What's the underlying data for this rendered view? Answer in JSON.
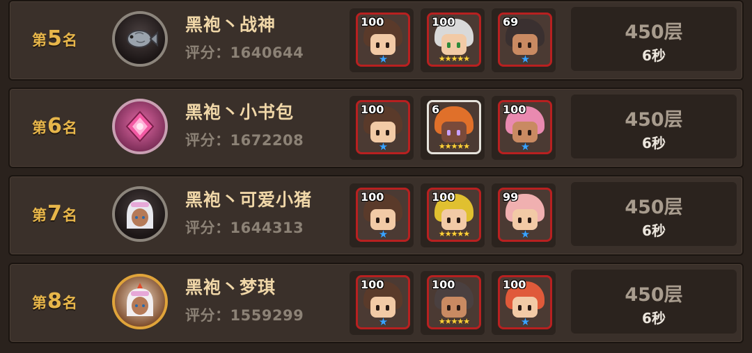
{
  "rankings": [
    {
      "rank_prefix": "第",
      "rank_number": "5",
      "rank_suffix": "名",
      "avatar_icon": "fish-avatar-icon",
      "name": "黑袍丶战神",
      "score": "评分：1640644",
      "heroes": [
        {
          "level": "100",
          "stars": "★",
          "star_color": "blue",
          "hair": "#5a3a2a"
        },
        {
          "level": "100",
          "stars": "★★★★★",
          "star_color": "gold",
          "hair": "#d9d9d9"
        },
        {
          "level": "69",
          "stars": "★",
          "star_color": "blue",
          "hair": "#3a3030"
        }
      ],
      "floor": "450层",
      "time": "6秒"
    },
    {
      "rank_prefix": "第",
      "rank_number": "6",
      "rank_suffix": "名",
      "avatar_icon": "pink-gem-avatar-icon",
      "name": "黑袍丶小书包",
      "score": "评分：1672208",
      "heroes": [
        {
          "level": "100",
          "stars": "★",
          "star_color": "blue",
          "hair": "#5a3a2a"
        },
        {
          "level": "6",
          "stars": "★★★★★",
          "star_color": "gold",
          "hair": "#e0702a"
        },
        {
          "level": "100",
          "stars": "★",
          "star_color": "blue",
          "hair": "#e98ab0"
        }
      ],
      "floor": "450层",
      "time": "6秒"
    },
    {
      "rank_prefix": "第",
      "rank_number": "7",
      "rank_suffix": "名",
      "avatar_icon": "white-hair-girl-avatar-icon",
      "name": "黑袍丶可爱小猪",
      "score": "评分：1644313",
      "heroes": [
        {
          "level": "100",
          "stars": "★",
          "star_color": "blue",
          "hair": "#5a3a2a"
        },
        {
          "level": "100",
          "stars": "★★★★★",
          "star_color": "gold",
          "hair": "#e0c030"
        },
        {
          "level": "99",
          "stars": "★",
          "star_color": "blue",
          "hair": "#f0b0b0"
        }
      ],
      "floor": "450层",
      "time": "6秒"
    },
    {
      "rank_prefix": "第",
      "rank_number": "8",
      "rank_suffix": "名",
      "avatar_icon": "crowned-girl-avatar-icon",
      "name": "黑袍丶梦琪",
      "score": "评分：1559299",
      "heroes": [
        {
          "level": "100",
          "stars": "★",
          "star_color": "blue",
          "hair": "#5a3a2a"
        },
        {
          "level": "100",
          "stars": "★★★★★",
          "star_color": "gold",
          "hair": "#4a4040"
        },
        {
          "level": "100",
          "stars": "★",
          "star_color": "blue",
          "hair": "#e05a3a"
        }
      ],
      "floor": "450层",
      "time": "6秒"
    }
  ],
  "colors": {
    "rank_gold": "#e7b64a",
    "name": "#f0d7a8",
    "card_border_red": "#b82020",
    "card_border_white": "#e6e3dc"
  }
}
